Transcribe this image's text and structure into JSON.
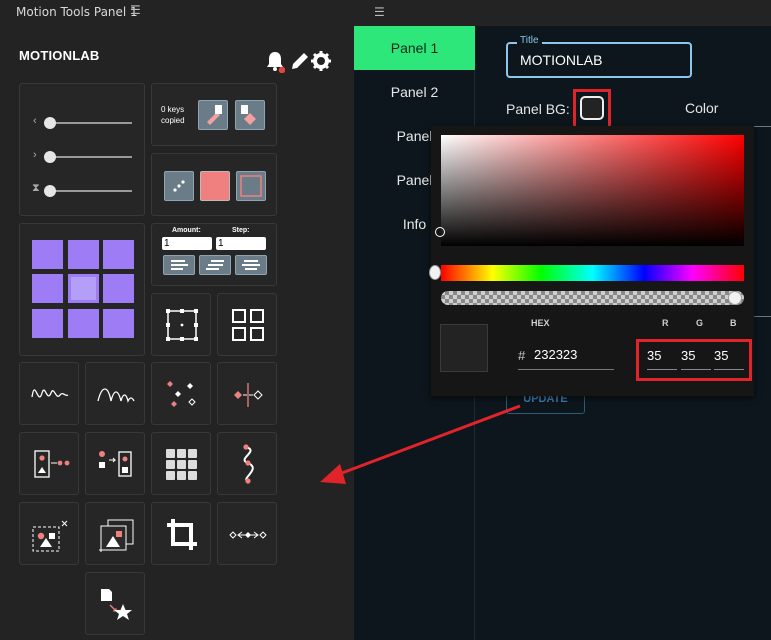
{
  "left_panel": {
    "title": "Motion Tools Panel 1",
    "menu_icon": "hamburger-icon",
    "brand": "MOTIONLAB",
    "toolbar_icons": [
      "bell-icon",
      "pencil-icon",
      "gear-icon"
    ],
    "keys_status_line1": "0 keys",
    "keys_status_line2": "copied",
    "amount_label": "Amount:",
    "step_label": "Step:",
    "amount_value": "1",
    "step_value": "1"
  },
  "right_panel": {
    "menu_icon": "hamburger-icon",
    "tabs": [
      {
        "label": "Panel 1",
        "active": true
      },
      {
        "label": "Panel 2",
        "active": false
      },
      {
        "label": "Panel",
        "active": false
      },
      {
        "label": "Panel",
        "active": false
      },
      {
        "label": "Info",
        "active": false
      }
    ],
    "title_field_label": "Title",
    "title_field_value": "MOTIONLAB",
    "panel_bg_label": "Panel BG:",
    "color_label": "Color",
    "update_button": "UPDATE"
  },
  "color_picker": {
    "hex_label": "HEX",
    "hash": "#",
    "hex_value": "232323",
    "r_label": "R",
    "g_label": "G",
    "b_label": "B",
    "r": "35",
    "g": "35",
    "b": "35"
  },
  "colors": {
    "accent_green": "#2ee77a",
    "highlight_red": "#e0242a",
    "field_blue": "#8ac7ea",
    "swatch_purple": "#9e7cf6",
    "panel_bg": "#232323"
  }
}
